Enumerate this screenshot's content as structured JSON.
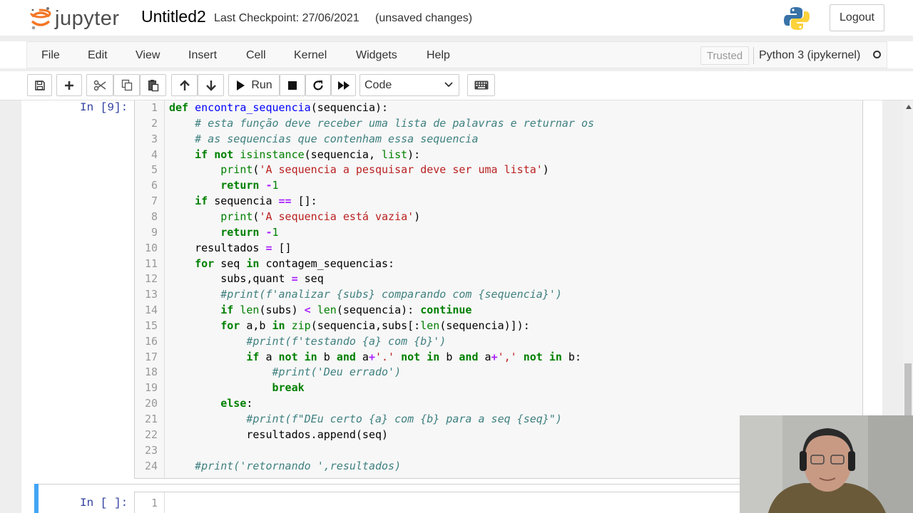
{
  "header": {
    "logo_text": "jupyter",
    "notebook_title": "Untitled2",
    "checkpoint": "Last Checkpoint: 27/06/2021",
    "status": "(unsaved changes)",
    "logout_label": "Logout"
  },
  "menu": {
    "items": [
      "File",
      "Edit",
      "View",
      "Insert",
      "Cell",
      "Kernel",
      "Widgets",
      "Help"
    ],
    "trusted_label": "Trusted",
    "kernel_name": "Python 3 (ipykernel)"
  },
  "toolbar": {
    "run_label": "Run",
    "cell_type": "Code"
  },
  "cells": [
    {
      "prompt": "In [9]:",
      "lines": [
        "def encontra_sequencia(sequencia):",
        "    # esta função deve receber uma lista de palavras e returnar os",
        "    # as sequencias que contenham essa sequencia",
        "    if not isinstance(sequencia, list):",
        "        print('A sequencia a pesquisar deve ser uma lista')",
        "        return -1",
        "    if sequencia == []:",
        "        print('A sequencia está vazia')",
        "        return -1",
        "    resultados = []",
        "    for seq in contagem_sequencias:",
        "        subs,quant = seq",
        "        #print(f'analizar {subs} comparando com {sequencia}')",
        "        if len(subs) < len(sequencia): continue",
        "        for a,b in zip(sequencia,subs[:len(sequencia)]):",
        "            #print(f'testando {a} com {b}')",
        "            if a not in b and a+'.' not in b and a+',' not in b:",
        "                #print('Deu errado')",
        "                break",
        "        else:",
        "            #print(f\"DEu certo {a} com {b} para a seq {seq}\")",
        "            resultados.append(seq)",
        "",
        "    #print('retornando ',resultados)"
      ]
    },
    {
      "prompt": "In [ ]:",
      "lines": [
        ""
      ]
    }
  ]
}
